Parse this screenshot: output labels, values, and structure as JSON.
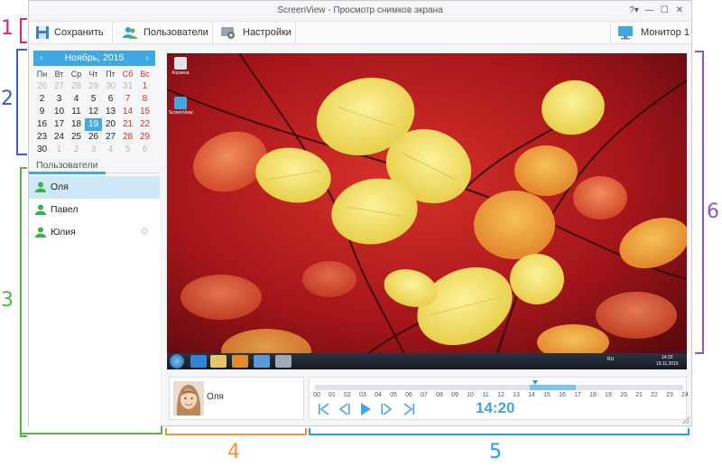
{
  "window": {
    "title": "ScreenView - Просмотр снимков экрана",
    "controls": [
      "?▾",
      "—",
      "☐",
      "✕"
    ]
  },
  "toolbar": {
    "save": "Сохранить",
    "users": "Пользователи",
    "settings": "Настройки",
    "monitor": "Монитор 1"
  },
  "calendar": {
    "header": "Ноябрь, 2015",
    "prev": "‹",
    "next": "›",
    "weekdays": [
      "Пн",
      "Вт",
      "Ср",
      "Чт",
      "Пт",
      "Сб",
      "Вс"
    ],
    "weeks": [
      [
        "26",
        "27",
        "28",
        "29",
        "30",
        "31",
        "1"
      ],
      [
        "2",
        "3",
        "4",
        "5",
        "6",
        "7",
        "8"
      ],
      [
        "9",
        "10",
        "11",
        "12",
        "13",
        "14",
        "15"
      ],
      [
        "16",
        "17",
        "18",
        "19",
        "20",
        "21",
        "22"
      ],
      [
        "23",
        "24",
        "25",
        "26",
        "27",
        "28",
        "29"
      ],
      [
        "30",
        "1",
        "2",
        "3",
        "4",
        "5",
        "6"
      ]
    ],
    "selected": "19"
  },
  "users": {
    "tab": "Пользователи",
    "items": [
      {
        "name": "Оля",
        "active": true
      },
      {
        "name": "Павел",
        "active": false
      },
      {
        "name": "Юлия",
        "active": false
      }
    ]
  },
  "screenshot": {
    "icons": [
      "Корзина",
      "ScreenView"
    ],
    "tray_lang": "RU",
    "tray_time": "14:20",
    "tray_date": "19.11.2015"
  },
  "current_user": {
    "name": "Оля"
  },
  "timeline": {
    "hours": [
      "00",
      "01",
      "02",
      "03",
      "04",
      "05",
      "06",
      "07",
      "08",
      "09",
      "10",
      "11",
      "12",
      "13",
      "14",
      "15",
      "16",
      "17",
      "18",
      "19",
      "20",
      "21",
      "22",
      "23",
      "24"
    ],
    "selection_start_hour": 14,
    "selection_end_hour": 17,
    "marker_hour": 14.33,
    "time": "14:20"
  },
  "annotations": [
    "1",
    "2",
    "3",
    "4",
    "5",
    "6"
  ],
  "colors": {
    "accent": "#3fa8e3",
    "weekend": "#d9302c",
    "user_icon": "#37b34a"
  }
}
